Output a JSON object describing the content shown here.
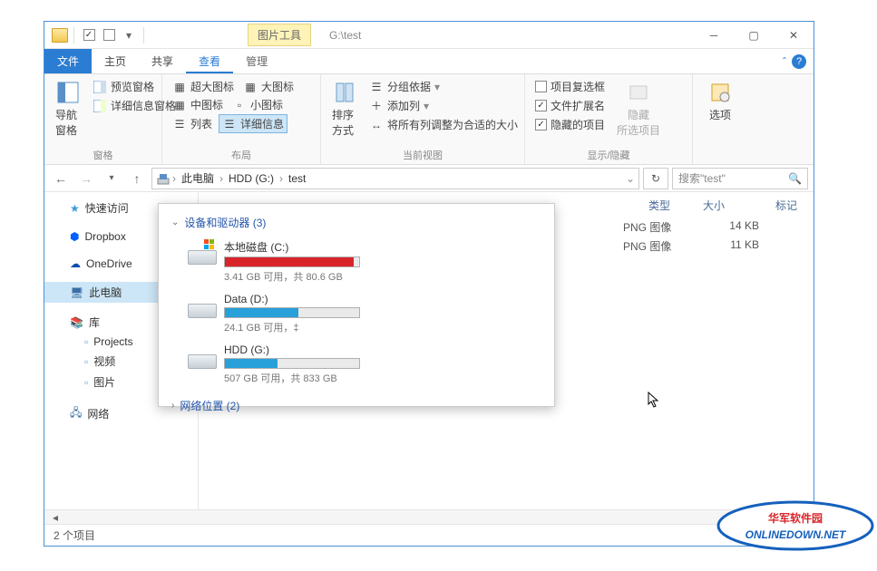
{
  "title": {
    "tool_tab": "图片工具",
    "path": "G:\\test"
  },
  "tabs": {
    "file": "文件",
    "home": "主页",
    "share": "共享",
    "view": "查看",
    "manage": "管理"
  },
  "ribbon": {
    "panes": {
      "nav": "导航窗格",
      "preview": "预览窗格",
      "detail": "详细信息窗格"
    },
    "layout": {
      "xl": "超大图标",
      "lg": "大图标",
      "md": "中图标",
      "sm": "小图标",
      "list": "列表",
      "detail": "详细信息"
    },
    "view": {
      "sort": "排序方式",
      "group": "分组依据",
      "addcol": "添加列",
      "fitcol": "将所有列调整为合适的大小"
    },
    "show": {
      "itemcheck": "项目复选框",
      "ext": "文件扩展名",
      "hidden": "隐藏的项目",
      "hide": "隐藏\n所选项目"
    },
    "options": "选项",
    "groups": {
      "panes": "窗格",
      "layout": "布局",
      "view": "当前视图",
      "show": "显示/隐藏"
    }
  },
  "breadcrumb": {
    "pc": "此电脑",
    "drive": "HDD (G:)",
    "folder": "test"
  },
  "search": {
    "placeholder": "搜索\"test\""
  },
  "sidebar": {
    "quick": "快速访问",
    "dropbox": "Dropbox",
    "onedrive": "OneDrive",
    "pc": "此电脑",
    "lib": "库",
    "projects": "Projects",
    "video": "视频",
    "pictures": "图片",
    "network": "网络"
  },
  "columns": {
    "type": "类型",
    "size": "大小",
    "tag": "标记"
  },
  "files": [
    {
      "type": "PNG 图像",
      "size": "14 KB"
    },
    {
      "type": "PNG 图像",
      "size": "11 KB"
    }
  ],
  "popup": {
    "devices_header": "设备和驱动器 (3)",
    "network_header": "网络位置 (2)",
    "drives": [
      {
        "name": "本地磁盘 (C:)",
        "free": "3.41 GB 可用，共 80.6 GB",
        "fill": 96,
        "color": "#d9252a",
        "win": true
      },
      {
        "name": "Data (D:)",
        "free": "24.1 GB 可用，‡",
        "fill": 55,
        "color": "#28a0da",
        "win": false
      },
      {
        "name": "HDD (G:)",
        "free": "507 GB 可用，共 833 GB",
        "fill": 39,
        "color": "#28a0da",
        "win": false
      }
    ]
  },
  "status": {
    "count": "2 个项目"
  },
  "watermark": {
    "line1": "华军软件园",
    "line2": "ONLINEDOWN.NET"
  }
}
